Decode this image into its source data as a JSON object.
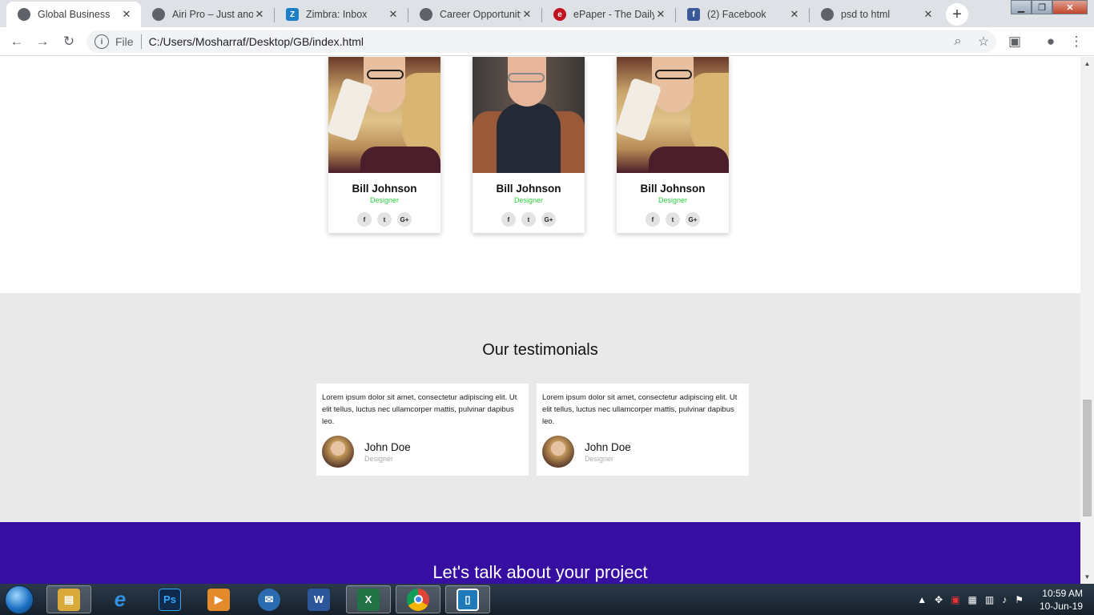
{
  "browser": {
    "tabs": [
      {
        "title": "Global Business",
        "icon": "globe-icon",
        "active": true
      },
      {
        "title": "Airi Pro – Just anoth",
        "icon": "globe-icon",
        "active": false
      },
      {
        "title": "Zimbra: Inbox",
        "icon": "zimbra-icon",
        "active": false
      },
      {
        "title": "Career Opportunity",
        "icon": "globe-icon",
        "active": false
      },
      {
        "title": "ePaper - The Daily",
        "icon": "epaper-icon",
        "active": false
      },
      {
        "title": "(2) Facebook",
        "icon": "facebook-icon",
        "active": false
      },
      {
        "title": "psd to html",
        "icon": "globe-icon",
        "active": false
      }
    ],
    "address": {
      "scheme": "File",
      "url": "C:/Users/Mosharraf/Desktop/GB/index.html"
    }
  },
  "team": {
    "members": [
      {
        "name": "Bill Johnson",
        "role": "Designer",
        "photo": "woman-with-coffee"
      },
      {
        "name": "Bill Johnson",
        "role": "Designer",
        "photo": "man-with-glasses"
      },
      {
        "name": "Bill Johnson",
        "role": "Designer",
        "photo": "woman-with-coffee"
      }
    ],
    "social_icons": [
      "facebook-icon",
      "twitter-icon",
      "google-plus-icon"
    ]
  },
  "testimonials": {
    "heading": "Our testimonials",
    "items": [
      {
        "text": "Lorem ipsum dolor sit amet, consectetur adipiscing elit. Ut elit tellus, luctus nec ullamcorper mattis, pulvinar dapibus leo.",
        "author": "John Doe",
        "role": "Designer"
      },
      {
        "text": "Lorem ipsum dolor sit amet, consectetur adipiscing elit. Ut elit tellus, luctus nec ullamcorper mattis, pulvinar dapibus leo.",
        "author": "John Doe",
        "role": "Designer"
      }
    ]
  },
  "cta": {
    "heading": "Let's talk about your project"
  },
  "taskbar": {
    "apps": [
      "windows-explorer",
      "internet-explorer",
      "photoshop",
      "media-player",
      "thunderbird",
      "word",
      "excel",
      "chrome",
      "frame-app"
    ],
    "clock": {
      "time": "10:59 AM",
      "date": "10-Jun-19"
    }
  },
  "colors": {
    "accent_green": "#2ecc40",
    "cta_purple": "#360fa2",
    "testimonial_bg": "#e9e9e9"
  }
}
